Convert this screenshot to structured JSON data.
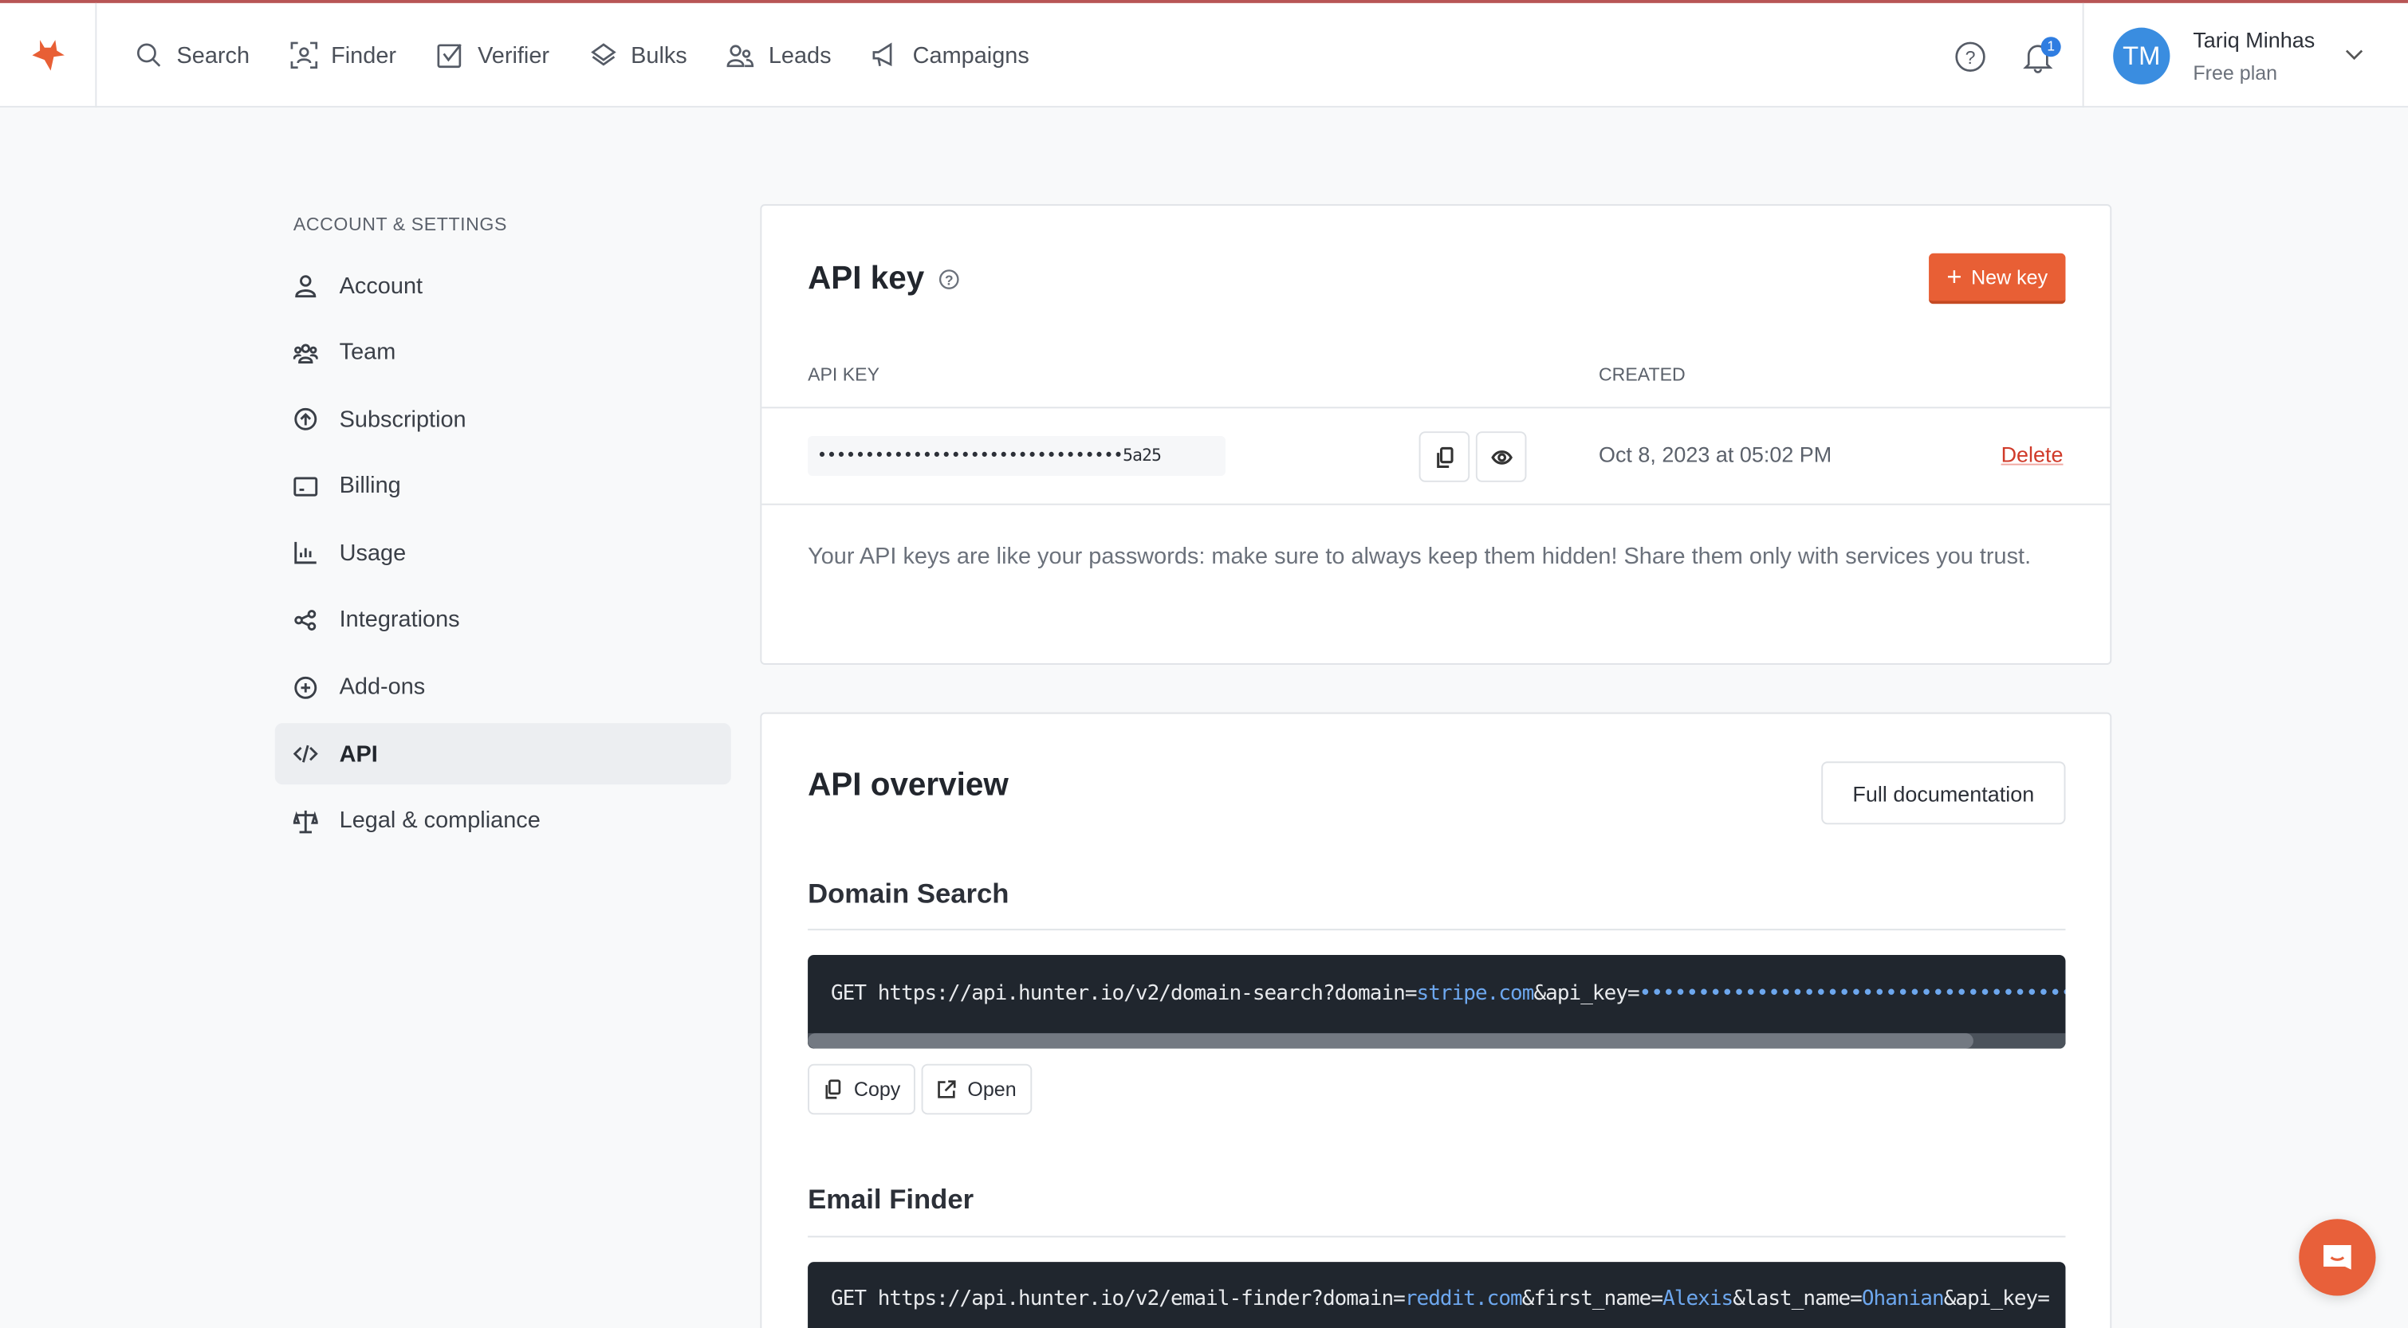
{
  "colors": {
    "accent": "#e85f35",
    "link": "#6da7ee",
    "danger": "#d03b2a",
    "code_bg": "#20262e",
    "avatar": "#3a8de0"
  },
  "nav": {
    "items": [
      {
        "label": "Search",
        "icon": "search-icon"
      },
      {
        "label": "Finder",
        "icon": "finder-icon"
      },
      {
        "label": "Verifier",
        "icon": "verifier-icon"
      },
      {
        "label": "Bulks",
        "icon": "layers-icon"
      },
      {
        "label": "Leads",
        "icon": "users-icon"
      },
      {
        "label": "Campaigns",
        "icon": "megaphone-icon"
      }
    ],
    "notification_count": "1"
  },
  "user": {
    "initials": "TM",
    "name": "Tariq Minhas",
    "plan": "Free plan"
  },
  "sidebar": {
    "heading": "ACCOUNT & SETTINGS",
    "items": [
      {
        "label": "Account"
      },
      {
        "label": "Team"
      },
      {
        "label": "Subscription"
      },
      {
        "label": "Billing"
      },
      {
        "label": "Usage"
      },
      {
        "label": "Integrations"
      },
      {
        "label": "Add-ons"
      },
      {
        "label": "API",
        "active": true
      },
      {
        "label": "Legal & compliance"
      }
    ]
  },
  "api_key": {
    "title": "API key",
    "new_key": "New key",
    "col_key": "API KEY",
    "col_created": "CREATED",
    "key_masked": "••••••••••••••••••••••••••••••••5a25",
    "created": "Oct 8, 2023 at 05:02 PM",
    "delete": "Delete",
    "note": "Your API keys are like your passwords: make sure to always keep them hidden! Share them only with services you trust."
  },
  "overview": {
    "title": "API overview",
    "docs": "Full documentation",
    "copy": "Copy",
    "open": "Open",
    "domain_search": {
      "title": "Domain Search",
      "prefix": "GET https://api.hunter.io/v2/domain-search?domain=",
      "domain": "stripe.com",
      "mid": "&api_key=",
      "key": "••••••••••••••••••••••••••••••••••••••"
    },
    "email_finder": {
      "title": "Email Finder",
      "prefix": "GET https://api.hunter.io/v2/email-finder?domain=",
      "domain": "reddit.com",
      "p1": "&first_name=",
      "first": "Alexis",
      "p2": "&last_name=",
      "last": "Ohanian",
      "p3": "&api_key="
    }
  }
}
